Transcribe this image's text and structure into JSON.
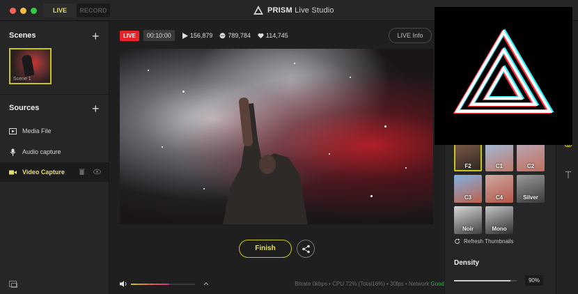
{
  "titlebar": {
    "tabs": [
      {
        "label": "LIVE",
        "active": true
      },
      {
        "label": "RECORD",
        "active": false
      }
    ],
    "app_name_bold": "PRISM",
    "app_name_rest": "Live Studio"
  },
  "sidebar": {
    "scenes_title": "Scenes",
    "scene_label": "Scene 1",
    "sources_title": "Sources",
    "sources": [
      {
        "label": "Media File",
        "icon": "media-file-icon"
      },
      {
        "label": "Audio capture",
        "icon": "microphone-icon"
      },
      {
        "label": "Video Capture",
        "icon": "video-camera-icon",
        "active": true
      }
    ]
  },
  "stats": {
    "live_badge": "LIVE",
    "timer": "00:10:00",
    "views": "156,879",
    "comments": "789,784",
    "likes": "114,745",
    "live_info_label": "LIVE Info"
  },
  "controls": {
    "finish_label": "Finish",
    "volume_level": 0.6
  },
  "status": {
    "prefix": "Bitrate 0kbps • CPU 72% (Total16%) • 30fps • Network ",
    "network_state": "Good"
  },
  "filters": {
    "tiles": [
      {
        "label": "F2",
        "selected": true
      },
      {
        "label": "C1"
      },
      {
        "label": "C2"
      },
      {
        "label": "C3"
      },
      {
        "label": "C4"
      },
      {
        "label": "Silver"
      },
      {
        "label": "Noir"
      },
      {
        "label": "Mono"
      }
    ],
    "refresh_label": "Refresh Thumbnails"
  },
  "density": {
    "title": "Density",
    "value_label": "90%",
    "value": 0.9
  },
  "colors": {
    "accent": "#c7c61e",
    "live_red": "#e8242b",
    "network_good": "#36b84a"
  }
}
